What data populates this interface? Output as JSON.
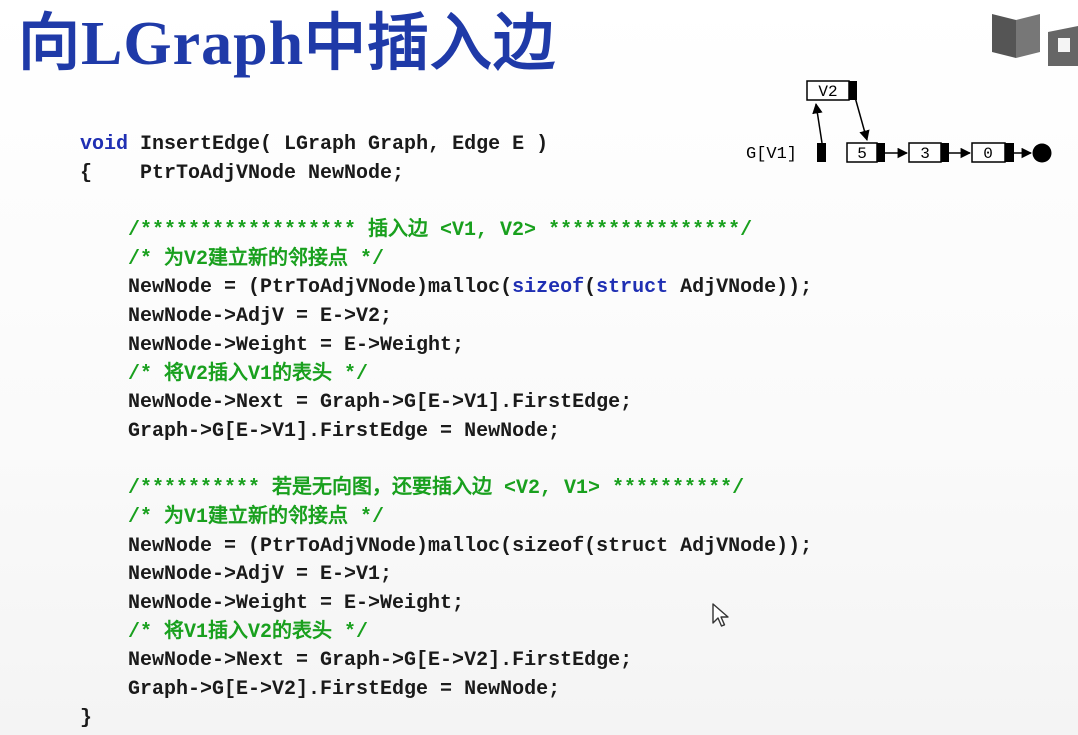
{
  "slide": {
    "title": "向LGraph中插入边"
  },
  "diagram": {
    "head_label": "G[V1]",
    "new_node_label": "V2",
    "list_nodes": [
      "5",
      "3",
      "0"
    ]
  },
  "code": {
    "line01": {
      "kw": "void",
      "text": " InsertEdge( LGraph Graph, Edge E )"
    },
    "line02": "{    PtrToAdjVNode NewNode;",
    "line03": "",
    "line04": "    /****************** 插入边 <V1, V2> ****************/",
    "line05": "    /* 为V2建立新的邻接点 */",
    "line06": {
      "p1": "    NewNode = (PtrToAdjVNode)malloc(",
      "kw1": "sizeof",
      "p2": "(",
      "kw2": "struct",
      "p3": " AdjVNode));"
    },
    "line07": "    NewNode->AdjV = E->V2;",
    "line08": "    NewNode->Weight = E->Weight;",
    "line09": "    /* 将V2插入V1的表头 */",
    "line10": "    NewNode->Next = Graph->G[E->V1].FirstEdge;",
    "line11": "    Graph->G[E->V1].FirstEdge = NewNode;",
    "line12": "",
    "line13": "    /********** 若是无向图，还要插入边 <V2, V1> **********/",
    "line14": "    /* 为V1建立新的邻接点 */",
    "line15": "    NewNode = (PtrToAdjVNode)malloc(sizeof(struct AdjVNode));",
    "line16": "    NewNode->AdjV = E->V1;",
    "line17": "    NewNode->Weight = E->Weight;",
    "line18": "    /* 将V1插入V2的表头 */",
    "line19": "    NewNode->Next = Graph->G[E->V2].FirstEdge;",
    "line20": "    Graph->G[E->V2].FirstEdge = NewNode;",
    "line21": "}"
  }
}
